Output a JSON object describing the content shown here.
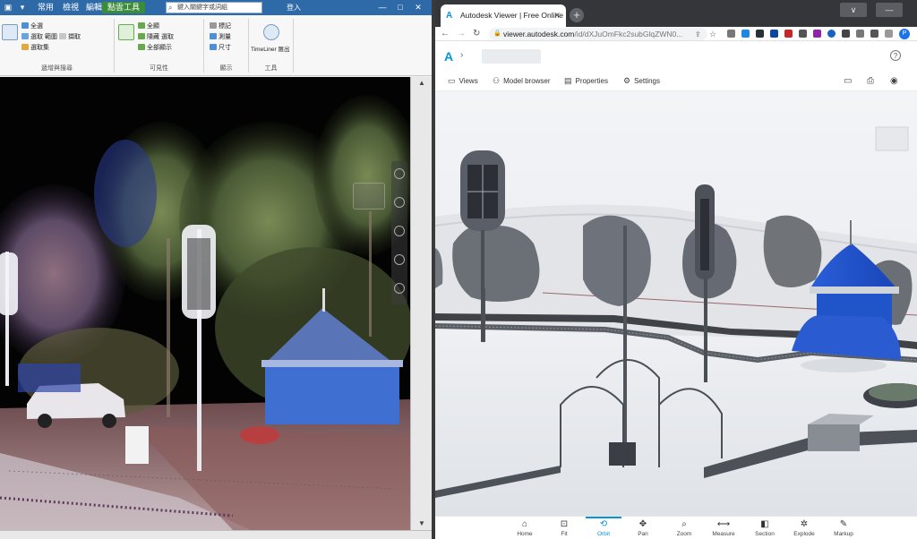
{
  "left_app": {
    "search_placeholder": "鍵入關鍵字或詞組",
    "user": "登入",
    "tabs": [
      {
        "label": "常用",
        "active": false
      },
      {
        "label": "檢視",
        "active": false
      },
      {
        "label": "編輯",
        "active": false
      },
      {
        "label": "點雲工具",
        "active": true
      }
    ],
    "ribbon_groups": [
      {
        "title": "遞增與搜尋",
        "items": [
          "全選",
          "選取 範圍",
          "擷取",
          "選取 工具",
          "選取集"
        ]
      },
      {
        "title": "可見性",
        "items": [
          "全顯",
          "隱藏 選取",
          "全部顯示",
          "隱藏未選取",
          "隱藏"
        ]
      },
      {
        "title": "顯示",
        "items": [
          "標記",
          "測量",
          "字 的 物件",
          "尺寸"
        ]
      },
      {
        "title": "工具",
        "items": [
          "TimeLiner 匯出"
        ]
      }
    ]
  },
  "browser": {
    "tab_title": "Autodesk Viewer | Free Online",
    "url_main": "viewer.autodesk.com",
    "url_rest": "/id/dXJuOmFkc2subGlqZWN0...",
    "profile_initial": "P",
    "window_controls": [
      "∨",
      "—",
      "□",
      "✕"
    ]
  },
  "viewer": {
    "toolbar": [
      {
        "icon": "views-icon",
        "glyph": "▭",
        "label": "Views"
      },
      {
        "icon": "model-browser-icon",
        "glyph": "⚇",
        "label": "Model browser"
      },
      {
        "icon": "properties-icon",
        "glyph": "▤",
        "label": "Properties"
      },
      {
        "icon": "settings-icon",
        "glyph": "⚙",
        "label": "Settings"
      }
    ],
    "bottom_tools": [
      {
        "icon": "home-icon",
        "glyph": "⌂",
        "label": "Home",
        "active": false
      },
      {
        "icon": "fit-icon",
        "glyph": "⊡",
        "label": "Fit",
        "active": false
      },
      {
        "icon": "orbit-icon",
        "glyph": "⟲",
        "label": "Orbit",
        "active": true
      },
      {
        "icon": "pan-icon",
        "glyph": "✥",
        "label": "Pan",
        "active": false
      },
      {
        "icon": "zoom-icon",
        "glyph": "⌕",
        "label": "Zoom",
        "active": false
      },
      {
        "icon": "measure-icon",
        "glyph": "⟷",
        "label": "Measure",
        "active": false
      },
      {
        "icon": "section-icon",
        "glyph": "◧",
        "label": "Section",
        "active": false
      },
      {
        "icon": "explode-icon",
        "glyph": "✲",
        "label": "Explode",
        "active": false
      },
      {
        "icon": "markup-icon",
        "glyph": "✎",
        "label": "Markup",
        "active": false
      }
    ]
  },
  "colors": {
    "autodesk_blue": "#0696d7",
    "kiosk_blue": "#1f55c8",
    "ribbon_active_tab": "#3a8b3a"
  }
}
